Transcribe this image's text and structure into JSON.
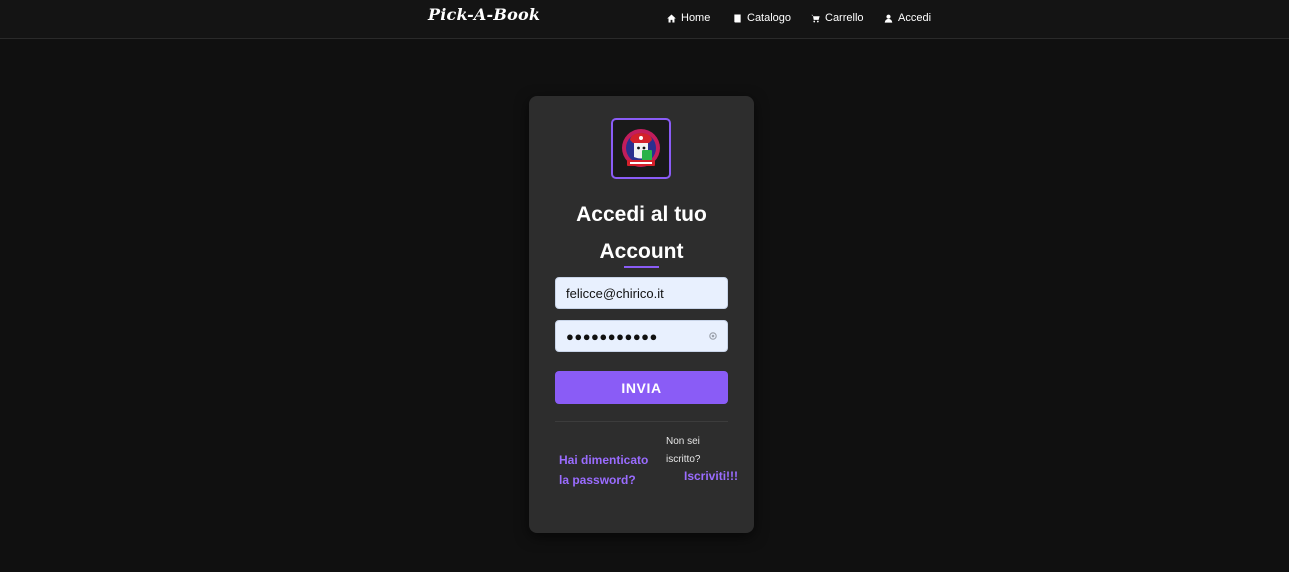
{
  "navbar": {
    "brand": "Pick-A-Book",
    "links": [
      {
        "label": "Home",
        "icon": "home-icon"
      },
      {
        "label": "Catalogo",
        "icon": "book-icon"
      },
      {
        "label": "Carrello",
        "icon": "cart-icon"
      },
      {
        "label": "Accedi",
        "icon": "user-icon"
      }
    ]
  },
  "login": {
    "logo_icon": "pick-a-book-logo",
    "title_line1": "Accedi al tuo",
    "title_line2": "Account",
    "email_value": "felicce@chirico.it",
    "password_value": "●●●●●●●●●●●",
    "password_toggle_icon": "eye-icon",
    "submit_label": "INVIA",
    "forgot_password": "Hai dimenticato la password?",
    "not_registered": "Non sei iscritto?",
    "register_link": "Iscriviti!!!"
  },
  "colors": {
    "background": "#101010",
    "card": "#2d2d2d",
    "accent": "#8a5cf6",
    "input_bg": "#e8f0fe"
  }
}
